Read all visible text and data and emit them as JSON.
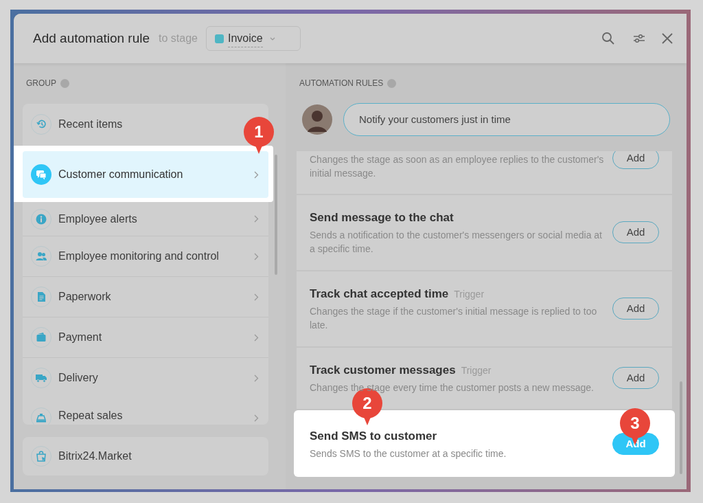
{
  "header": {
    "title": "Add automation rule",
    "subtitle": "to stage",
    "stage": {
      "label": "Invoice",
      "color": "#4fb6c4"
    }
  },
  "group": {
    "heading": "GROUP",
    "items": [
      {
        "label": "Recent items",
        "selected": false,
        "highlighted": false
      },
      {
        "label": "Customer communication",
        "selected": true,
        "highlighted": true
      },
      {
        "label": "Employee alerts",
        "selected": false,
        "highlighted": false
      },
      {
        "label": "Employee monitoring and control",
        "selected": false,
        "highlighted": false
      },
      {
        "label": "Paperwork",
        "selected": false,
        "highlighted": false
      },
      {
        "label": "Payment",
        "selected": false,
        "highlighted": false
      },
      {
        "label": "Delivery",
        "selected": false,
        "highlighted": false
      },
      {
        "label": "Repeat sales",
        "selected": false,
        "highlighted": false
      }
    ],
    "market": {
      "label": "Bitrix24.Market"
    }
  },
  "rules": {
    "heading": "AUTOMATION RULES",
    "hint": "Notify your customers just in time",
    "items": [
      {
        "description": "Changes the stage as soon as an employee replies to the customer's initial message.",
        "action": "Add",
        "highlighted": false
      },
      {
        "title": "Send message to the chat",
        "description": "Sends a notification to the customer's messengers or social media at a specific time.",
        "action": "Add",
        "highlighted": false
      },
      {
        "title": "Track chat accepted time",
        "tag": "Trigger",
        "description": "Changes the stage if the customer's initial message is replied to too late.",
        "action": "Add",
        "highlighted": false
      },
      {
        "title": "Track customer messages",
        "tag": "Trigger",
        "description": "Changes the stage every time the customer posts a new message.",
        "action": "Add",
        "highlighted": false
      },
      {
        "title": "Send SMS to customer",
        "description": "Sends SMS to the customer at a specific time.",
        "action": "Add",
        "highlighted": true
      }
    ]
  },
  "callouts": [
    "1",
    "2",
    "3"
  ]
}
